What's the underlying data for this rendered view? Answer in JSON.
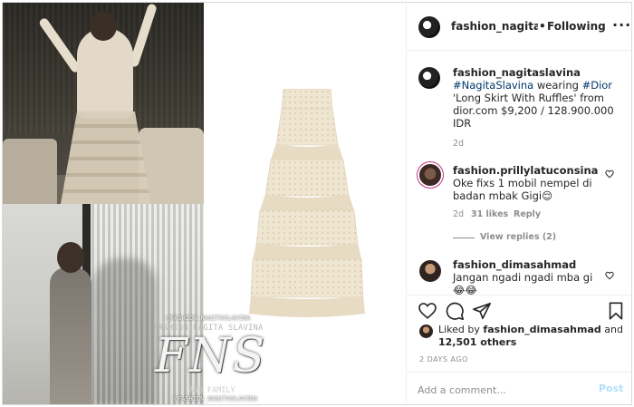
{
  "header": {
    "username": "fashion_nagitasl",
    "separator": "•",
    "follow_status": "Following",
    "more_icon": "more-options-icon",
    "more_label": "···"
  },
  "watermark": {
    "handle_top": "@FASHION_NAGITASLAVINA",
    "name": "FASHION NAGITA SLAVINA",
    "logo": "FNS",
    "family": "AND FAMILY",
    "handle_bottom": "@FASHION_NAGITASLAVINA"
  },
  "caption": {
    "username": "fashion_nagitaslavina",
    "tag_person": "#NagitaSlavina",
    "text_mid": " wearing ",
    "tag_brand": "#Dior",
    "text_rest": " 'Long Skirt With Ruffles' from dior.com $9,200 / 128.900.000 IDR",
    "time": "2d"
  },
  "comments": [
    {
      "username": "fashion.prillylatuconsina",
      "text": "Oke fixs 1 mobil nempel di badan mbak Gigi😌",
      "time": "2d",
      "likes": "31 likes",
      "reply": "Reply"
    },
    {
      "username": "fashion_dimasahmad",
      "text": "Jangan ngadi ngadi mba gi 😂😂"
    }
  ],
  "view_replies": "View replies (2)",
  "likes": {
    "prefix": "Liked by ",
    "user": "fashion_dimasahmad",
    "middle": " and ",
    "count": "12,501 others"
  },
  "timestamp": "2 DAYS AGO",
  "add_comment": {
    "placeholder": "Add a comment...",
    "post_label": "Post"
  },
  "colors": {
    "link": "#00376b",
    "muted": "#8e8e8e",
    "post_button": "#b2dffc",
    "skirt": "#efe6d2"
  }
}
